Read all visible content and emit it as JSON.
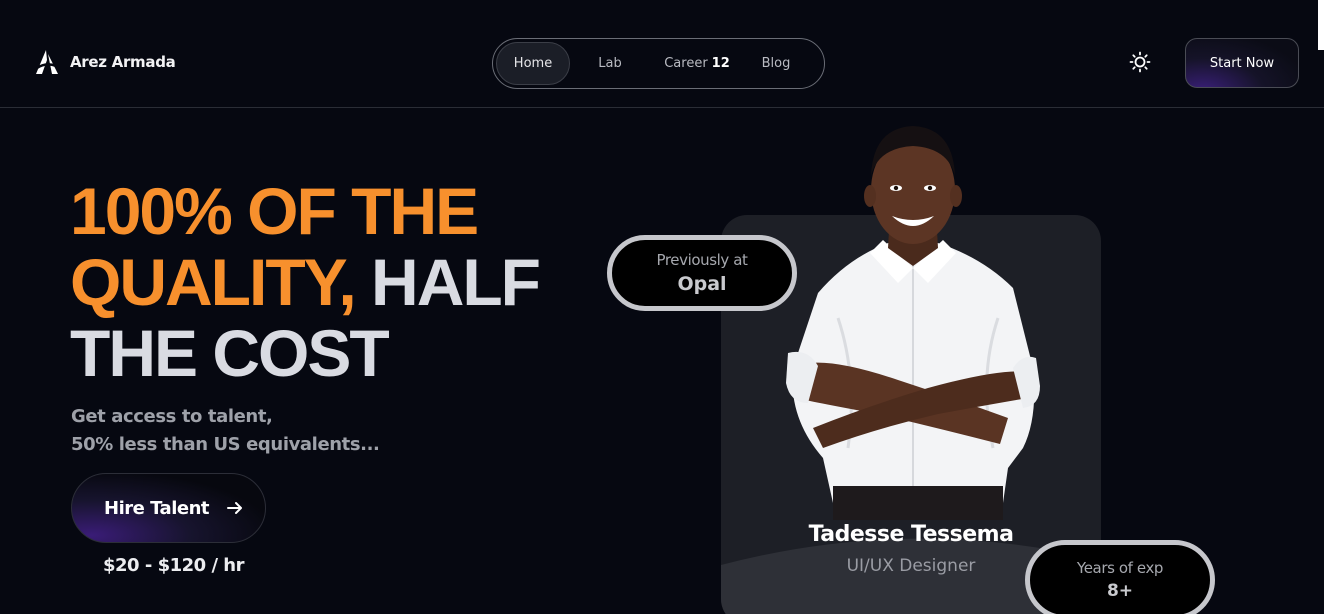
{
  "brand": {
    "name": "Arez Armada"
  },
  "nav": {
    "items": [
      {
        "label": "Home",
        "active": true
      },
      {
        "label": "Lab"
      },
      {
        "label": "Career",
        "count": "12"
      },
      {
        "label": "Blog"
      }
    ]
  },
  "header": {
    "theme_icon": "sun-icon",
    "cta_label": "Start Now"
  },
  "hero": {
    "title_highlight_1": "100% OF THE",
    "title_highlight_2": "QUALITY,",
    "title_plain_1": "HALF",
    "title_plain_2": "THE COST",
    "subtitle_line1": "Get access to talent,",
    "subtitle_line2": "50% less than US equivalents...",
    "cta_label": "Hire Talent",
    "rate": "$20 - $120 / hr"
  },
  "profile": {
    "name": "Tadesse Tessema",
    "role": "UI/UX Designer",
    "previous_label": "Previously at",
    "previous_company": "Opal",
    "exp_label": "Years of exp",
    "exp_value": "8+"
  },
  "colors": {
    "background": "#060811",
    "accent_orange": "#f7902d",
    "card": "#1d1f26",
    "purple_glow": "#3a1c77"
  }
}
